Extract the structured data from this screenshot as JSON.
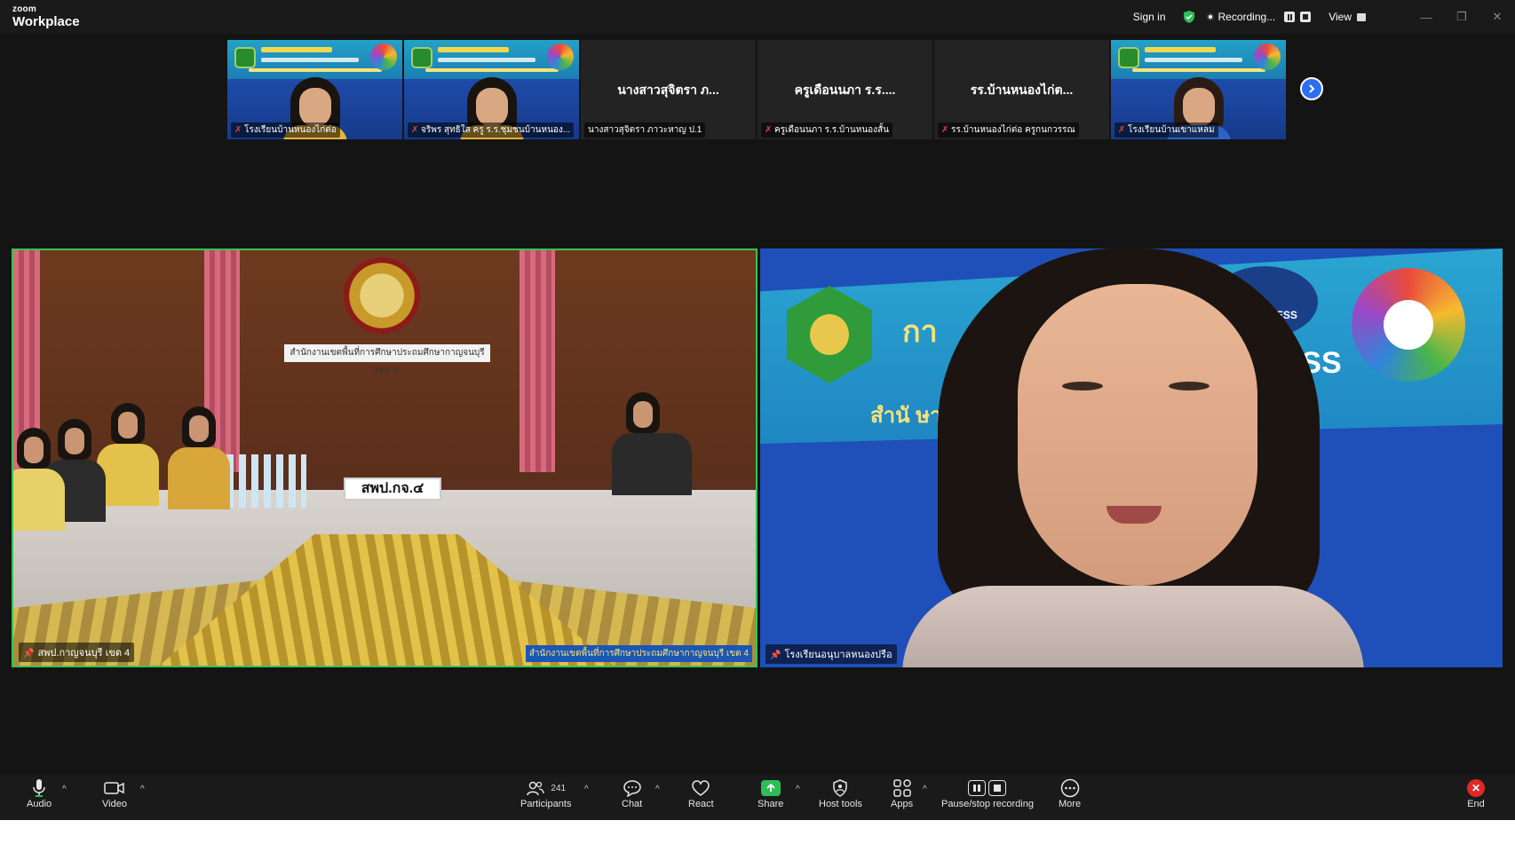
{
  "app": {
    "brand_small": "zoom",
    "brand_large": "Workplace",
    "sign_in": "Sign in",
    "recording_label": "Recording...",
    "view_label": "View",
    "window_min": "—",
    "window_restore": "❐",
    "window_close": "✕"
  },
  "gallery": {
    "tiles": [
      {
        "type": "video",
        "name": "โรงเรียนบ้านหนองไก่ต่อ"
      },
      {
        "type": "video",
        "name": "จริพร สุทธิใส ครู ร.ร.ชุมชนบ้านหนอง..."
      },
      {
        "type": "name",
        "display": "นางสาวสุจิตรา ภ...",
        "name": "นางสาวสุจิตรา ภาวะหาญ ป.1"
      },
      {
        "type": "name",
        "display": "ครูเดือนนภา ร.ร....",
        "name": "ครูเดือนนภา ร.ร.บ้านหนองสั้น"
      },
      {
        "type": "name",
        "display": "รร.บ้านหนองไก่ต...",
        "name": "รร.บ้านหนองไก่ต่อ ครูกนกวรรณ"
      },
      {
        "type": "video",
        "name": "โรงเรียนบ้านเขาแหลม"
      }
    ]
  },
  "main": {
    "left": {
      "name": "สพป.กาญจนบุรี เขต 4",
      "plaque": "สำนักงานเขตพื้นที่การศึกษาประถมศึกษากาญจนบุรี เขต ๔",
      "placard": "สพป.กจ.๔",
      "tv_caption": "สำนักงานเขตพื้นที่การศึกษาประถมศึกษากาญจนบุรี เขต 4"
    },
    "right": {
      "name": "โรงเรียนอนุบาลหนองปรือ",
      "bg_title": "กา",
      "bg_access": "T ACCESS",
      "bg_sub": "สำนั                              ษากาญจนบุรี เขต 4",
      "nt_logo_text": "NT ACCESS"
    }
  },
  "toolbar": {
    "audio": "Audio",
    "video": "Video",
    "participants": "Participants",
    "participants_count": "241",
    "chat": "Chat",
    "react": "React",
    "share": "Share",
    "host_tools": "Host tools",
    "apps": "Apps",
    "pause_stop": "Pause/stop recording",
    "more": "More",
    "end": "End"
  },
  "colors": {
    "active_speaker_border": "#36c44e",
    "share_green": "#2ebd59",
    "end_red": "#e02828",
    "next_blue": "#2d6ef5"
  }
}
